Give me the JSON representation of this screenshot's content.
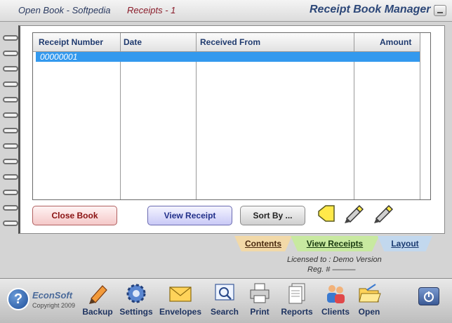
{
  "titlebar": {
    "book": "Open Book - Softpedia",
    "receipts": "Receipts - 1",
    "app_name": "Receipt Book Manager 7"
  },
  "table": {
    "columns": [
      "Receipt Number",
      "Date",
      "Received From",
      "Amount"
    ],
    "rows": [
      {
        "receipt_number": "00000001",
        "date": "",
        "received_from": "",
        "amount": "",
        "selected": true
      }
    ]
  },
  "buttons": {
    "close_book": "Close Book",
    "view_receipt": "View Receipt",
    "sort_by": "Sort By ..."
  },
  "action_icons": [
    "label-icon",
    "edit-pencil-icon",
    "edit-pencil-icon"
  ],
  "tabs": [
    {
      "label": "Contents",
      "active": false
    },
    {
      "label": "View Receipts",
      "active": true
    },
    {
      "label": "Layout",
      "active": false
    }
  ],
  "license": {
    "licensed_to": "Licensed to : Demo Version",
    "reg": "Reg. # ———"
  },
  "logo": {
    "glyph": "?",
    "name": "EconSoft",
    "copyright": "Copyright 2009"
  },
  "toolbar": [
    {
      "label": "Backup",
      "icon": "pencil-icon"
    },
    {
      "label": "Settings",
      "icon": "gear-icon"
    },
    {
      "label": "Envelopes",
      "icon": "envelope-icon"
    },
    {
      "label": "Search",
      "icon": "search-icon"
    },
    {
      "label": "Print",
      "icon": "printer-icon"
    },
    {
      "label": "Reports",
      "icon": "reports-icon"
    },
    {
      "label": "Clients",
      "icon": "clients-icon"
    },
    {
      "label": "Open",
      "icon": "open-folder-icon"
    }
  ],
  "colors": {
    "selection": "#3399ee",
    "header_text": "#1f3a6e"
  }
}
